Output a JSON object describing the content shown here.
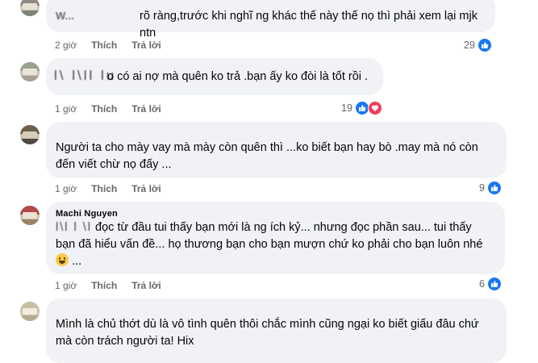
{
  "colors": {
    "bubble_bg": "#f0f2f5",
    "meta_text": "#65676b",
    "like_blue": "#1877f2",
    "love_red": "#f33e58"
  },
  "comments": [
    {
      "author": "W...",
      "text": "rõ ràng,trước khi nghĩ ng khác thế này thế nọ thì phải xem lại mjk ntn",
      "time": "2 giờ",
      "like_label": "Thích",
      "reply_label": "Trả lời",
      "reaction_count": "29",
      "reactions": [
        "like-icon"
      ]
    },
    {
      "author": "",
      "redacted_prefix": "l\\ l\\ll lu",
      "text": "o có ai nợ mà quên ko trả .bạn ấy ko đòi là tốt rồi .",
      "time": "1 giờ",
      "like_label": "Thích",
      "reply_label": "Trả lời",
      "reaction_count": "19",
      "reactions": [
        "like-icon",
        "heart-icon"
      ]
    },
    {
      "author": "",
      "text": "Người ta cho mày vay mà mày còn quên thì ...ko biết bạn hay bò .may mà nó còn đến viết chừ nọ đấy ...",
      "time": "1 giờ",
      "like_label": "Thích",
      "reply_label": "Trả lời",
      "reaction_count": "9",
      "reactions": [
        "like-icon"
      ]
    },
    {
      "author": "Machi Nguyen",
      "redacted_prefix": "l\\l l \\l",
      "text": "đọc từ đầu tui thấy bạn mới là ng ích kỷ... nhưng đọc phần sau... tui thấy bạn đã hiểu vấn đề... họ thương bạn cho bạn mượn chứ ko phải cho bạn luôn nhé",
      "text_suffix": "...",
      "time": "1 giờ",
      "like_label": "Thích",
      "reply_label": "Trả lời",
      "reaction_count": "6",
      "reactions": [
        "like-icon"
      ]
    },
    {
      "author": "",
      "text": "Mình là chủ thớt dù là vô tình quên thôi chắc mình cũng ngại ko biết giấu đâu chứ mà còn trách người ta! Hix"
    }
  ]
}
